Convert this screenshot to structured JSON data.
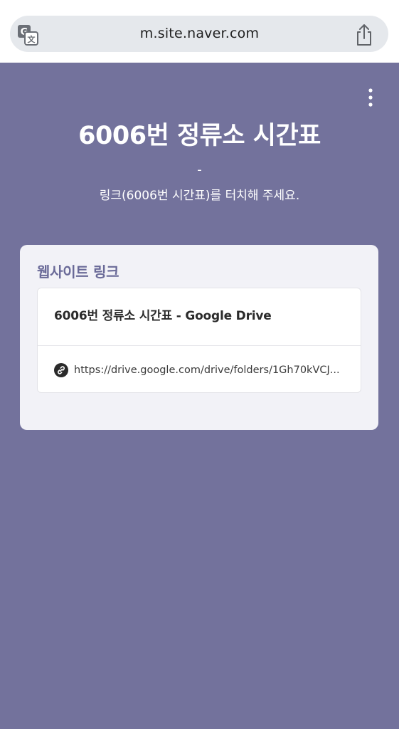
{
  "browser": {
    "url": "m.site.naver.com",
    "translate_icon": "translate-icon",
    "share_icon": "share-icon"
  },
  "page": {
    "more_icon": "more-vertical-icon",
    "title": "6006번 정류소 시간표",
    "separator": "-",
    "description": "링크(6006번 시간표)를 터치해 주세요."
  },
  "card": {
    "heading": "웹사이트 링크",
    "link": {
      "title": "6006번 정류소 시간표 - Google Drive",
      "url": "https://drive.google.com/drive/folders/1Gh70kVCJ...",
      "icon": "link-icon"
    }
  },
  "colors": {
    "page_background": "#73729c",
    "card_background": "#f2f2f7",
    "heading_accent": "#6a6a98",
    "url_bar": "#e5e8ec"
  }
}
